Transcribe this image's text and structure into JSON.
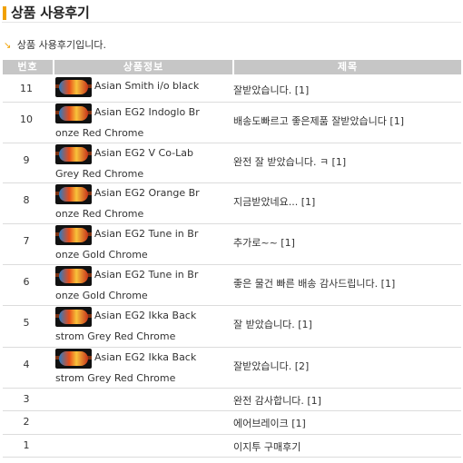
{
  "page": {
    "title": "상품 사용후기",
    "subtitle": "상품 사용후기입니다."
  },
  "table": {
    "headers": [
      "번호",
      "상품정보",
      "제목"
    ],
    "rows": [
      {
        "no": "11",
        "product_line1": "Asian Smith i/o black",
        "product_line2": "",
        "subject": "잘받았습니다. [1]",
        "has_thumb": true
      },
      {
        "no": "10",
        "product_line1": "Asian EG2 Indoglo Br",
        "product_line2": "onze Red Chrome",
        "subject": "배송도빠르고 좋은제품 잘받았습니다 [1]",
        "has_thumb": true
      },
      {
        "no": "9",
        "product_line1": "Asian EG2 V Co-Lab",
        "product_line2": "Grey Red Chrome",
        "subject": "완전 잘 받았습니다. ㅋ [1]",
        "has_thumb": true
      },
      {
        "no": "8",
        "product_line1": "Asian EG2 Orange Br",
        "product_line2": "onze Red Chrome",
        "subject": "지금받았네요... [1]",
        "has_thumb": true
      },
      {
        "no": "7",
        "product_line1": "Asian EG2 Tune in Br",
        "product_line2": "onze Gold Chrome",
        "subject": "추가로~~ [1]",
        "has_thumb": true
      },
      {
        "no": "6",
        "product_line1": "Asian EG2 Tune in Br",
        "product_line2": "onze Gold Chrome",
        "subject": "좋은 물건 빠른 배송 감사드립니다. [1]",
        "has_thumb": true
      },
      {
        "no": "5",
        "product_line1": "Asian EG2 Ikka Back",
        "product_line2": "strom Grey Red Chrome",
        "subject": "잘 받았습니다. [1]",
        "has_thumb": true
      },
      {
        "no": "4",
        "product_line1": "Asian EG2 Ikka Back",
        "product_line2": "strom Grey Red Chrome",
        "subject": "잘받았습니다. [2]",
        "has_thumb": true
      },
      {
        "no": "3",
        "product_line1": "",
        "product_line2": "",
        "subject": "완전 감사합니다. [1]",
        "has_thumb": false
      },
      {
        "no": "2",
        "product_line1": "",
        "product_line2": "",
        "subject": "에어브레이크 [1]",
        "has_thumb": false
      },
      {
        "no": "1",
        "product_line1": "",
        "product_line2": "",
        "subject": "이지투 구매후기",
        "has_thumb": false
      }
    ]
  },
  "colors": {
    "accent": "#f1a100",
    "header_bg": "#c6c6c6",
    "row_border": "#dcdcdc"
  }
}
